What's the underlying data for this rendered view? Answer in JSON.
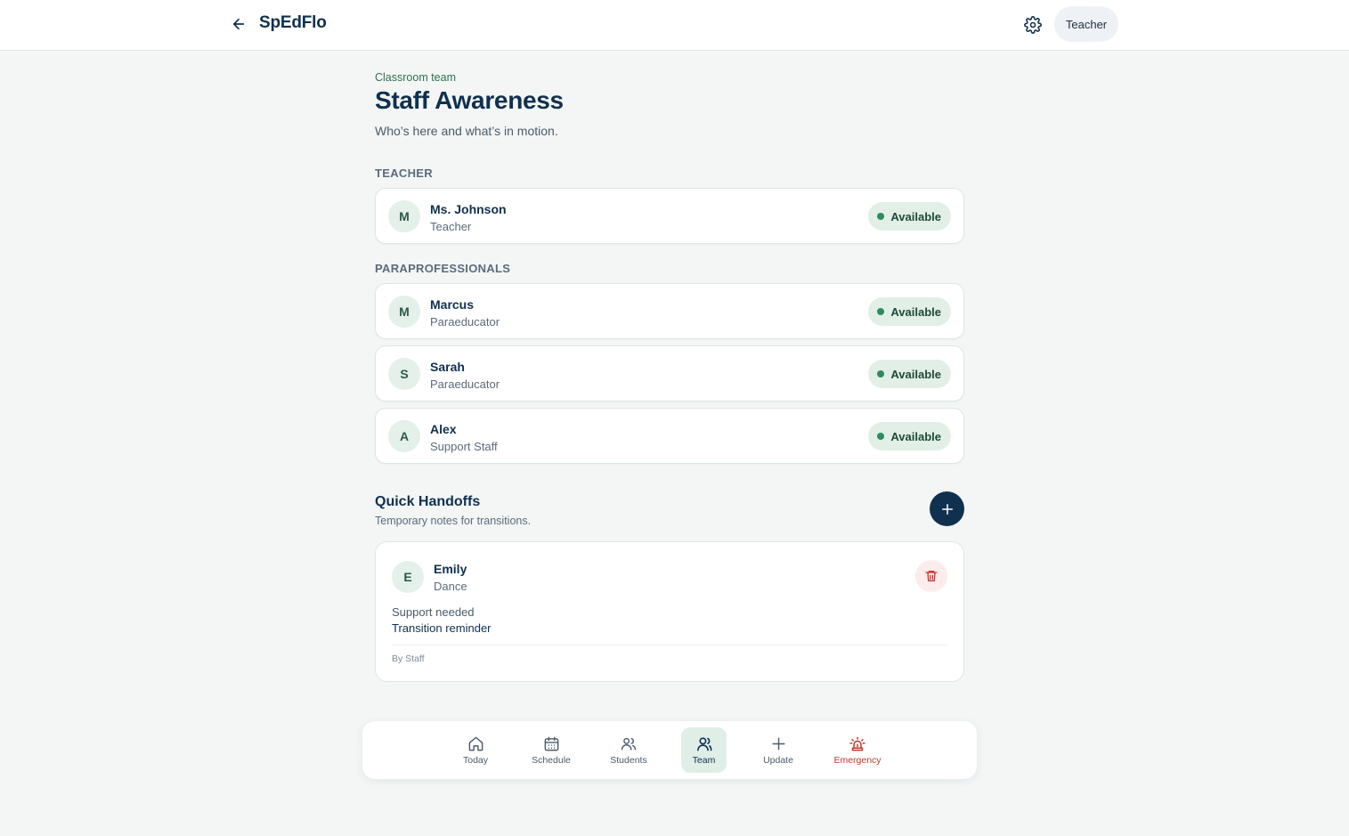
{
  "header": {
    "app_title": "SpEdFlo",
    "role_label": "Teacher"
  },
  "page": {
    "eyebrow": "Classroom team",
    "title": "Staff Awareness",
    "subtitle": "Who’s here and what’s in motion."
  },
  "sections": {
    "teacher_label": "TEACHER",
    "paras_label": "PARAPROFESSIONALS"
  },
  "teacher": [
    {
      "initial": "M",
      "name": "Ms. Johnson",
      "role": "Teacher",
      "status": "Available"
    }
  ],
  "paraprofessionals": [
    {
      "initial": "M",
      "name": "Marcus",
      "role": "Paraeducator",
      "status": "Available"
    },
    {
      "initial": "S",
      "name": "Sarah",
      "role": "Paraeducator",
      "status": "Available"
    },
    {
      "initial": "A",
      "name": "Alex",
      "role": "Support Staff",
      "status": "Available"
    }
  ],
  "handoffs": {
    "title": "Quick Handoffs",
    "subtitle": "Temporary notes for transitions.",
    "items": [
      {
        "initial": "E",
        "name": "Emily",
        "activity": "Dance",
        "label": "Support needed",
        "note": "Transition reminder",
        "author": "By Staff"
      }
    ]
  },
  "nav": {
    "items": [
      {
        "label": "Today",
        "icon": "home-icon"
      },
      {
        "label": "Schedule",
        "icon": "calendar-icon"
      },
      {
        "label": "Students",
        "icon": "users-icon"
      },
      {
        "label": "Team",
        "icon": "team-icon"
      },
      {
        "label": "Update",
        "icon": "plus-icon"
      },
      {
        "label": "Emergency",
        "icon": "siren-icon"
      }
    ],
    "active": "Team"
  },
  "colors": {
    "brand": "#10304f",
    "available": "#2f8a5c",
    "emergency": "#c0392b",
    "danger_bg": "#fdecec"
  }
}
